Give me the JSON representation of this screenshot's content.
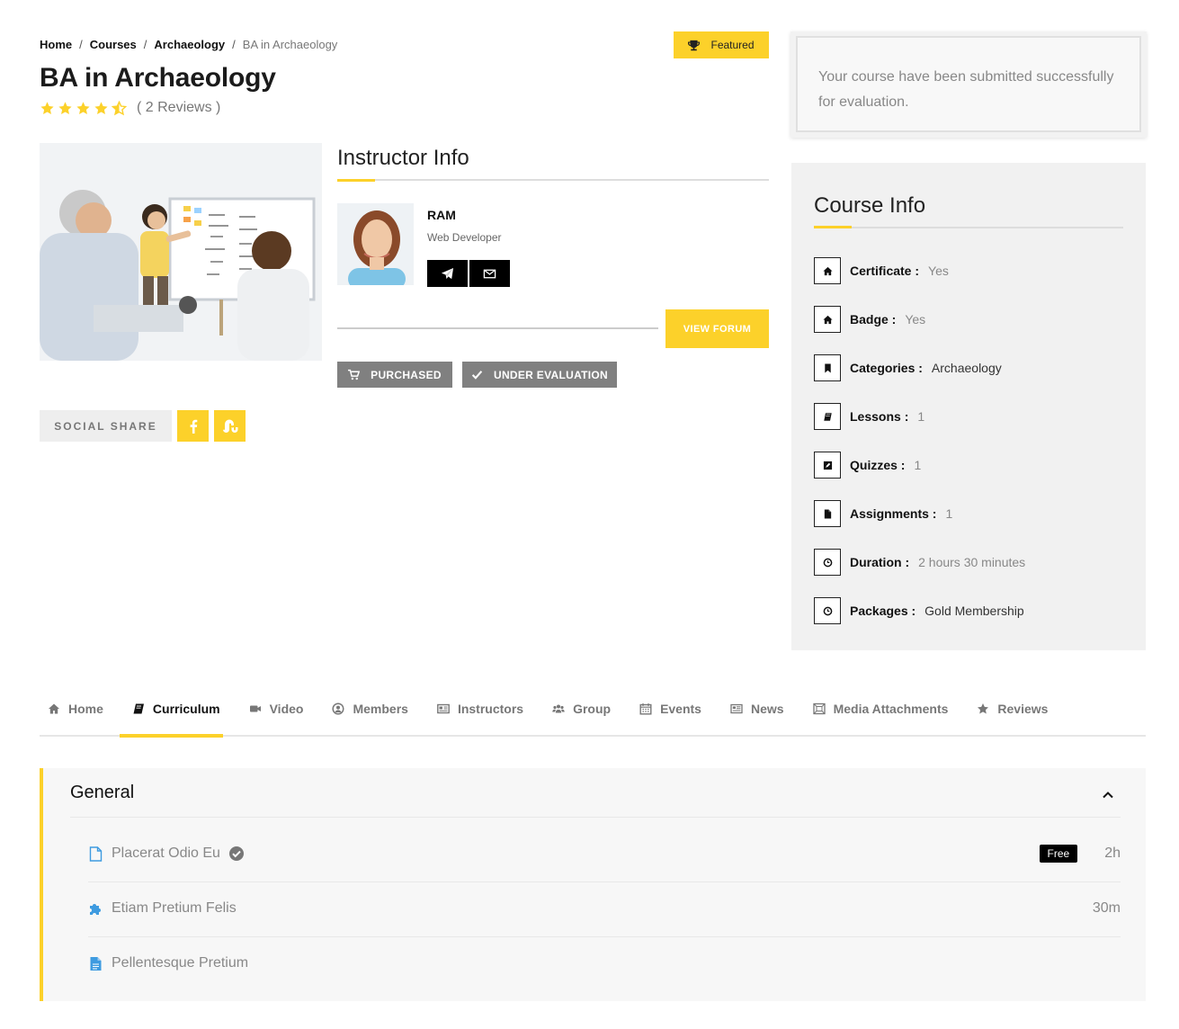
{
  "breadcrumb": {
    "items": [
      "Home",
      "Courses",
      "Archaeology"
    ],
    "current": "BA in Archaeology",
    "separator": "/"
  },
  "featured_label": "Featured",
  "course": {
    "title": "BA in Archaeology",
    "rating": 4.5,
    "rating_max": 5,
    "reviews_text": "( 2 Reviews )"
  },
  "instructor": {
    "heading": "Instructor Info",
    "name": "RAM",
    "role": "Web Developer"
  },
  "actions": {
    "view_forum": "VIEW FORUM",
    "purchased": "PURCHASED",
    "under_evaluation": "UNDER EVALUATION",
    "social_share": "SOCIAL SHARE"
  },
  "notice": "Your course have been submitted successfully for evaluation.",
  "course_info": {
    "heading": "Course Info",
    "rows": [
      {
        "icon": "home-icon",
        "label": "Certificate :",
        "value": "Yes"
      },
      {
        "icon": "home-icon",
        "label": "Badge :",
        "value": "Yes"
      },
      {
        "icon": "bookmark-icon",
        "label": "Categories :",
        "value": "Archaeology"
      },
      {
        "icon": "book-icon",
        "label": "Lessons :",
        "value": "1"
      },
      {
        "icon": "edit-icon",
        "label": "Quizzes :",
        "value": "1"
      },
      {
        "icon": "file-icon",
        "label": "Assignments :",
        "value": "1"
      },
      {
        "icon": "clock-icon",
        "label": "Duration :",
        "value": "2 hours 30 minutes"
      },
      {
        "icon": "clock-icon",
        "label": "Packages :",
        "value": "Gold Membership"
      }
    ]
  },
  "tabs": [
    {
      "icon": "home-icon",
      "label": "Home"
    },
    {
      "icon": "book-icon",
      "label": "Curriculum"
    },
    {
      "icon": "video-icon",
      "label": "Video"
    },
    {
      "icon": "user-circle-icon",
      "label": "Members"
    },
    {
      "icon": "id-card-icon",
      "label": "Instructors"
    },
    {
      "icon": "users-icon",
      "label": "Group"
    },
    {
      "icon": "calendar-icon",
      "label": "Events"
    },
    {
      "icon": "newspaper-icon",
      "label": "News"
    },
    {
      "icon": "image-icon",
      "label": "Media Attachments"
    },
    {
      "icon": "star-icon",
      "label": "Reviews"
    }
  ],
  "active_tab": "Curriculum",
  "curriculum": {
    "section_title": "General",
    "lessons": [
      {
        "icon": "file-outline-icon",
        "name": "Placerat Odio Eu",
        "completed": true,
        "badge": "Free",
        "duration": "2h"
      },
      {
        "icon": "puzzle-icon",
        "name": "Etiam Pretium Felis",
        "completed": false,
        "badge": "",
        "duration": "30m"
      },
      {
        "icon": "file-text-icon",
        "name": "Pellentesque Pretium",
        "completed": false,
        "badge": "",
        "duration": ""
      }
    ]
  },
  "colors": {
    "accent": "#fcd12a",
    "dark": "#000000",
    "gray_button": "#808080",
    "panel_bg": "#f1f1f1",
    "lesson_icon_blue": "#3e9be0"
  }
}
